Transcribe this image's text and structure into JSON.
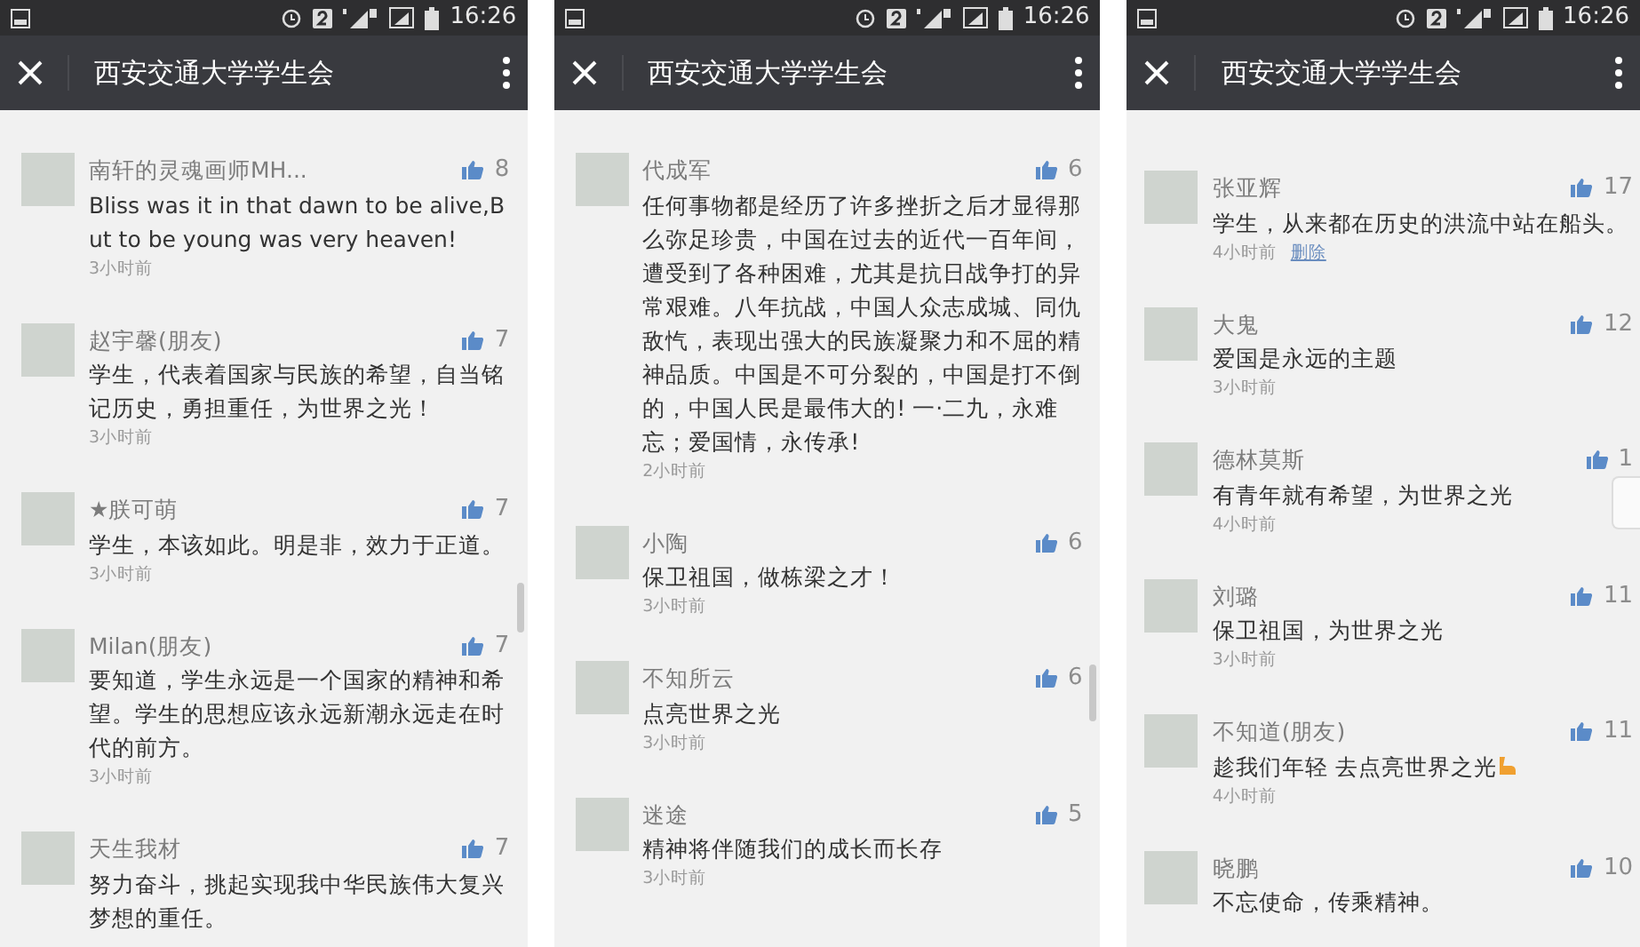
{
  "screens": [
    {
      "status_bar": {
        "time": "16:26"
      },
      "title": "西安交通大学学生会",
      "comments": [
        {
          "name": "南轩的灵魂画师MH...",
          "likes": "8",
          "text": "Bliss was it in that dawn to be alive,But to be young was very heaven!",
          "time": "3小时前"
        },
        {
          "name": "赵宇馨(朋友)",
          "likes": "7",
          "text": "学生，代表着国家与民族的希望，自当铭记历史，勇担重任，为世界之光！",
          "time": "3小时前"
        },
        {
          "name": "★朕可萌",
          "likes": "7",
          "text": "学生，本该如此。明是非，效力于正道。",
          "time": "3小时前"
        },
        {
          "name": "Milan(朋友)",
          "likes": "7",
          "text": "要知道，学生永远是一个国家的精神和希望。学生的思想应该永远新潮永远走在时代的前方。",
          "time": "3小时前"
        },
        {
          "name": "天生我材",
          "likes": "7",
          "text": "努力奋斗，挑起实现我中华民族伟大复兴梦想的重任。"
        }
      ]
    },
    {
      "status_bar": {
        "time": "16:26"
      },
      "title": "西安交通大学学生会",
      "comments": [
        {
          "name": "代成军",
          "likes": "6",
          "text": "任何事物都是经历了许多挫折之后才显得那么弥足珍贵，中国在过去的近代一百年间，遭受到了各种困难，尤其是抗日战争打的异常艰难。八年抗战，中国人众志成城、同仇敌忾，表现出强大的民族凝聚力和不屈的精神品质。中国是不可分裂的，中国是打不倒的，中国人民是最伟大的! 一·二九，永难忘；爱国情，永传承!",
          "time": "2小时前"
        },
        {
          "name": "小陶",
          "likes": "6",
          "text": "保卫祖国，做栋梁之才！",
          "time": "3小时前"
        },
        {
          "name": "不知所云",
          "likes": "6",
          "text": "点亮世界之光",
          "time": "3小时前"
        },
        {
          "name": "迷途",
          "likes": "5",
          "text": "精神将伴随我们的成长而长存",
          "time": "3小时前"
        }
      ]
    },
    {
      "status_bar": {
        "time": "16:26"
      },
      "title": "西安交通大学学生会",
      "comments": [
        {
          "name": "张亚辉",
          "likes": "17",
          "text": "学生，从来都在历史的洪流中站在船头。",
          "time": "4小时前",
          "delete_link": "删除"
        },
        {
          "name": "大鬼",
          "likes": "12",
          "text": "爱国是永远的主题",
          "time": "3小时前"
        },
        {
          "name": "德林莫斯",
          "likes": "1",
          "text": "有青年就有希望，为世界之光",
          "time": "4小时前"
        },
        {
          "name": "刘璐",
          "likes": "11",
          "text": "保卫祖国，为世界之光",
          "time": "3小时前"
        },
        {
          "name": "不知道(朋友)",
          "likes": "11",
          "text": "趁我们年轻 去点亮世界之光",
          "emoji_after": true,
          "time": "4小时前"
        },
        {
          "name": "晓鹏",
          "likes": "10",
          "text": "不忘使命，传乘精神。"
        }
      ]
    }
  ]
}
